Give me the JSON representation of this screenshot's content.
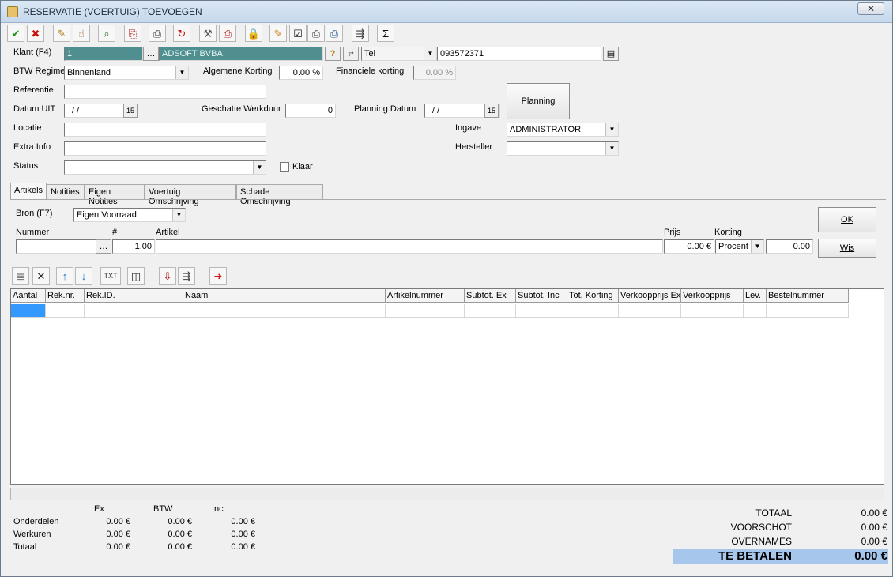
{
  "window": {
    "title": "RESERVATIE (VOERTUIG) TOEVOEGEN",
    "close": "✕"
  },
  "toolbar": {
    "icons": [
      {
        "name": "confirm-icon",
        "glyph": "✔",
        "color": "#1a8f1a"
      },
      {
        "name": "cancel-icon",
        "glyph": "✖",
        "color": "#cc1111"
      },
      {
        "name": "edit-icon",
        "glyph": "✎",
        "color": "#b07a10"
      },
      {
        "name": "hand-icon",
        "glyph": "☝",
        "color": "#8a4b1a"
      },
      {
        "name": "search-icon",
        "glyph": "⌕",
        "color": "#2a6e2a"
      },
      {
        "name": "copy-icon",
        "glyph": "⎘",
        "color": "#b01a1a"
      },
      {
        "name": "print-icon",
        "glyph": "⎙",
        "color": "#333333"
      },
      {
        "name": "refresh-icon",
        "glyph": "↻",
        "color": "#cc1111"
      },
      {
        "name": "tools-icon",
        "glyph": "⚒",
        "color": "#555555"
      },
      {
        "name": "print-red-icon",
        "glyph": "⎙",
        "color": "#b01a1a"
      },
      {
        "name": "lock-icon",
        "glyph": "🔒",
        "color": "#b07a10"
      },
      {
        "name": "note-edit-icon",
        "glyph": "✎",
        "color": "#cc7a10"
      },
      {
        "name": "checklist-icon",
        "glyph": "☑",
        "color": "#222222"
      },
      {
        "name": "print-list-icon",
        "glyph": "⎙",
        "color": "#333333"
      },
      {
        "name": "print-stack-icon",
        "glyph": "⎙",
        "color": "#225588"
      },
      {
        "name": "export-icon",
        "glyph": "⇶",
        "color": "#444444"
      },
      {
        "name": "sum-icon",
        "glyph": "Σ",
        "color": "#111111"
      }
    ]
  },
  "form": {
    "klant_label": "Klant (F4)",
    "klant_nr": "1",
    "klant_naam": "ADSOFT BVBA",
    "tel_type": "Tel",
    "tel_nummer": "093572371",
    "btw_label": "BTW Regime",
    "btw_value": "Binnenland",
    "alg_korting_label": "Algemene Korting",
    "alg_korting_value": "0.00 %",
    "fin_korting_label": "Financiele korting",
    "fin_korting_value": "0.00 %",
    "referentie_label": "Referentie",
    "referentie_value": "",
    "datum_uit_label": "Datum UIT",
    "datum_uit_value": "/ /",
    "werkduur_label": "Geschatte Werkduur",
    "werkduur_value": "0",
    "planning_datum_label": "Planning Datum",
    "planning_datum_value": "/ /",
    "planning_button": "Planning",
    "locatie_label": "Locatie",
    "locatie_value": "",
    "extra_info_label": "Extra Info",
    "extra_info_value": "",
    "status_label": "Status",
    "status_value": "",
    "klaar_label": "Klaar",
    "klaar_checked": false,
    "ingave_label": "Ingave",
    "ingave_value": "ADMINISTRATOR",
    "hersteller_label": "Hersteller",
    "hersteller_value": ""
  },
  "tabs": [
    {
      "label": "Artikels",
      "active": true
    },
    {
      "label": "Notities",
      "active": false
    },
    {
      "label": "Eigen Notities",
      "active": false
    },
    {
      "label": "Voertuig Omschrijving",
      "active": false
    },
    {
      "label": "Schade Omschrijving",
      "active": false
    }
  ],
  "article_entry": {
    "bron_label": "Bron (F7)",
    "bron_value": "Eigen Voorraad",
    "nummer_label": "Nummer",
    "hash_label": "#",
    "artikel_label": "Artikel",
    "prijs_label": "Prijs",
    "korting_label": "Korting",
    "nummer_value": "",
    "aantal_value": "1.00",
    "artikel_value": "",
    "prijs_value": "0.00 €",
    "korting_type": "Procent",
    "korting_value": "0.00",
    "ok_button": "OK",
    "wis_button": "Wis"
  },
  "grid_toolbar": {
    "icons": [
      {
        "name": "note-list-icon",
        "glyph": "▤",
        "color": "#555555"
      },
      {
        "name": "delete-icon",
        "glyph": "✕",
        "color": "#222222"
      },
      {
        "name": "move-up-icon",
        "glyph": "↑",
        "color": "#1a6ed8"
      },
      {
        "name": "move-down-icon",
        "glyph": "↓",
        "color": "#1a6ed8"
      },
      {
        "name": "txt-icon",
        "glyph": "TXT",
        "color": "#222222"
      },
      {
        "name": "columns-icon",
        "glyph": "◫",
        "color": "#222222"
      },
      {
        "name": "doc-red-icon",
        "glyph": "⇩",
        "color": "#b01a1a"
      },
      {
        "name": "doc-stack-icon",
        "glyph": "⇶",
        "color": "#444444"
      },
      {
        "name": "export-arrow-icon",
        "glyph": "➜",
        "color": "#cc1111"
      }
    ]
  },
  "grid": {
    "columns": [
      "Aantal",
      "Rek.nr.",
      "Rek.ID.",
      "Naam",
      "Artikelnummer",
      "Subtot. Ex",
      "Subtot. Inc",
      "Tot. Korting",
      "Verkoopprijs Ex",
      "Verkoopprijs",
      "Lev.",
      "Bestelnummer"
    ]
  },
  "totals": {
    "col_ex": "Ex",
    "col_btw": "BTW",
    "col_inc": "Inc",
    "rows": [
      {
        "label": "Onderdelen",
        "ex": "0.00 €",
        "btw": "0.00 €",
        "inc": "0.00 €"
      },
      {
        "label": "Werkuren",
        "ex": "0.00 €",
        "btw": "0.00 €",
        "inc": "0.00 €"
      },
      {
        "label": "Totaal",
        "ex": "0.00 €",
        "btw": "0.00 €",
        "inc": "0.00 €"
      }
    ],
    "totaal_label": "TOTAAL",
    "totaal_value": "0.00 €",
    "voorschot_label": "VOORSCHOT",
    "voorschot_value": "0.00 €",
    "overnames_label": "OVERNAMES",
    "overnames_value": "0.00 €",
    "te_betalen_label": "TE BETALEN",
    "te_betalen_value": "0.00 €"
  }
}
